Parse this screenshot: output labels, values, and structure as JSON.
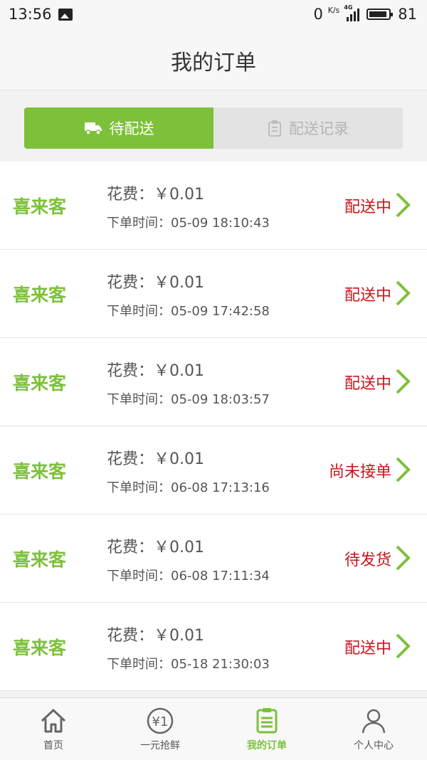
{
  "status_bar": {
    "time": "13:56",
    "speed_value": "0",
    "speed_unit": "K/s",
    "network": "4G",
    "battery": "81"
  },
  "header": {
    "title": "我的订单"
  },
  "tabs": [
    {
      "label": "待配送",
      "icon": "truck-icon",
      "active": true
    },
    {
      "label": "配送记录",
      "icon": "clipboard-icon",
      "active": false
    }
  ],
  "orders": [
    {
      "shop": "喜来客",
      "cost_label": "花费：",
      "cost": "￥0.01",
      "time_label": "下单时间：",
      "time": "05-09 18:10:43",
      "status": "配送中"
    },
    {
      "shop": "喜来客",
      "cost_label": "花费：",
      "cost": "￥0.01",
      "time_label": "下单时间：",
      "time": "05-09 17:42:58",
      "status": "配送中"
    },
    {
      "shop": "喜来客",
      "cost_label": "花费：",
      "cost": "￥0.01",
      "time_label": "下单时间：",
      "time": "05-09 18:03:57",
      "status": "配送中"
    },
    {
      "shop": "喜来客",
      "cost_label": "花费：",
      "cost": "￥0.01",
      "time_label": "下单时间：",
      "time": "06-08 17:13:16",
      "status": "尚未接单"
    },
    {
      "shop": "喜来客",
      "cost_label": "花费：",
      "cost": "￥0.01",
      "time_label": "下单时间：",
      "time": "06-08 17:11:34",
      "status": "待发货"
    },
    {
      "shop": "喜来客",
      "cost_label": "花费：",
      "cost": "￥0.01",
      "time_label": "下单时间：",
      "time": "05-18 21:30:03",
      "status": "配送中"
    }
  ],
  "bottom_nav": [
    {
      "label": "首页",
      "icon": "home-icon",
      "active": false
    },
    {
      "label": "一元抢鲜",
      "icon": "yuan-coin-icon",
      "active": false
    },
    {
      "label": "我的订单",
      "icon": "order-list-icon",
      "active": true
    },
    {
      "label": "个人中心",
      "icon": "user-icon",
      "active": false
    }
  ],
  "colors": {
    "accent": "#7dc13a",
    "status_red": "#c8161d"
  }
}
